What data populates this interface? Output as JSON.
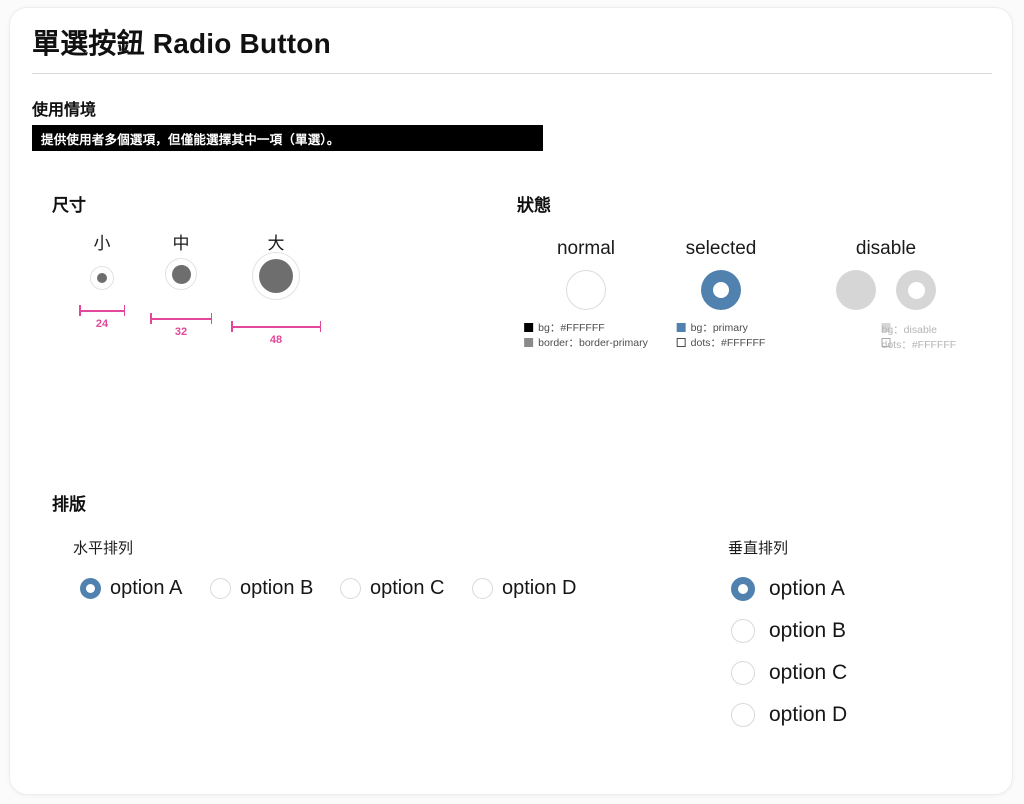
{
  "header": {
    "title": "單選按鈕 Radio Button"
  },
  "usage": {
    "heading": "使用情境",
    "description": "提供使用者多個選項，但僅能選擇其中一項（單選）。"
  },
  "sizes": {
    "heading": "尺寸",
    "items": [
      {
        "label": "小",
        "value": "24",
        "px": 24,
        "dot": 10
      },
      {
        "label": "中",
        "value": "32",
        "px": 32,
        "dot": 19
      },
      {
        "label": "大",
        "value": "48",
        "px": 48,
        "dot": 34
      }
    ]
  },
  "states": {
    "heading": "狀態",
    "items": [
      {
        "label": "normal",
        "legend": [
          {
            "swatch": "black",
            "text": "bg：#FFFFFF"
          },
          {
            "swatch": "gray",
            "text": "border：border-primary"
          }
        ]
      },
      {
        "label": "selected",
        "legend": [
          {
            "swatch": "blue",
            "text": "bg：primary"
          },
          {
            "swatch": "hollow",
            "text": "dots：#FFFFFF"
          }
        ]
      },
      {
        "label": "disable",
        "legend": [
          {
            "swatch": "dis",
            "text": "bg：disable"
          },
          {
            "swatch": "hollow-dim",
            "text": "dots：#FFFFFF"
          }
        ]
      }
    ]
  },
  "layout": {
    "heading": "排版",
    "horizontal": {
      "label": "水平排列",
      "options": [
        {
          "label": "option A",
          "selected": true
        },
        {
          "label": "option B",
          "selected": false
        },
        {
          "label": "option C",
          "selected": false
        },
        {
          "label": "option D",
          "selected": false
        }
      ]
    },
    "vertical": {
      "label": "垂直排列",
      "options": [
        {
          "label": "option A",
          "selected": true
        },
        {
          "label": "option B",
          "selected": false
        },
        {
          "label": "option C",
          "selected": false
        },
        {
          "label": "option D",
          "selected": false
        }
      ]
    }
  },
  "colors": {
    "primary": "#5182af",
    "disable": "#d6d6d6",
    "dimension": "#e2479a",
    "banner_bg": "#000000",
    "white": "#FFFFFF"
  }
}
